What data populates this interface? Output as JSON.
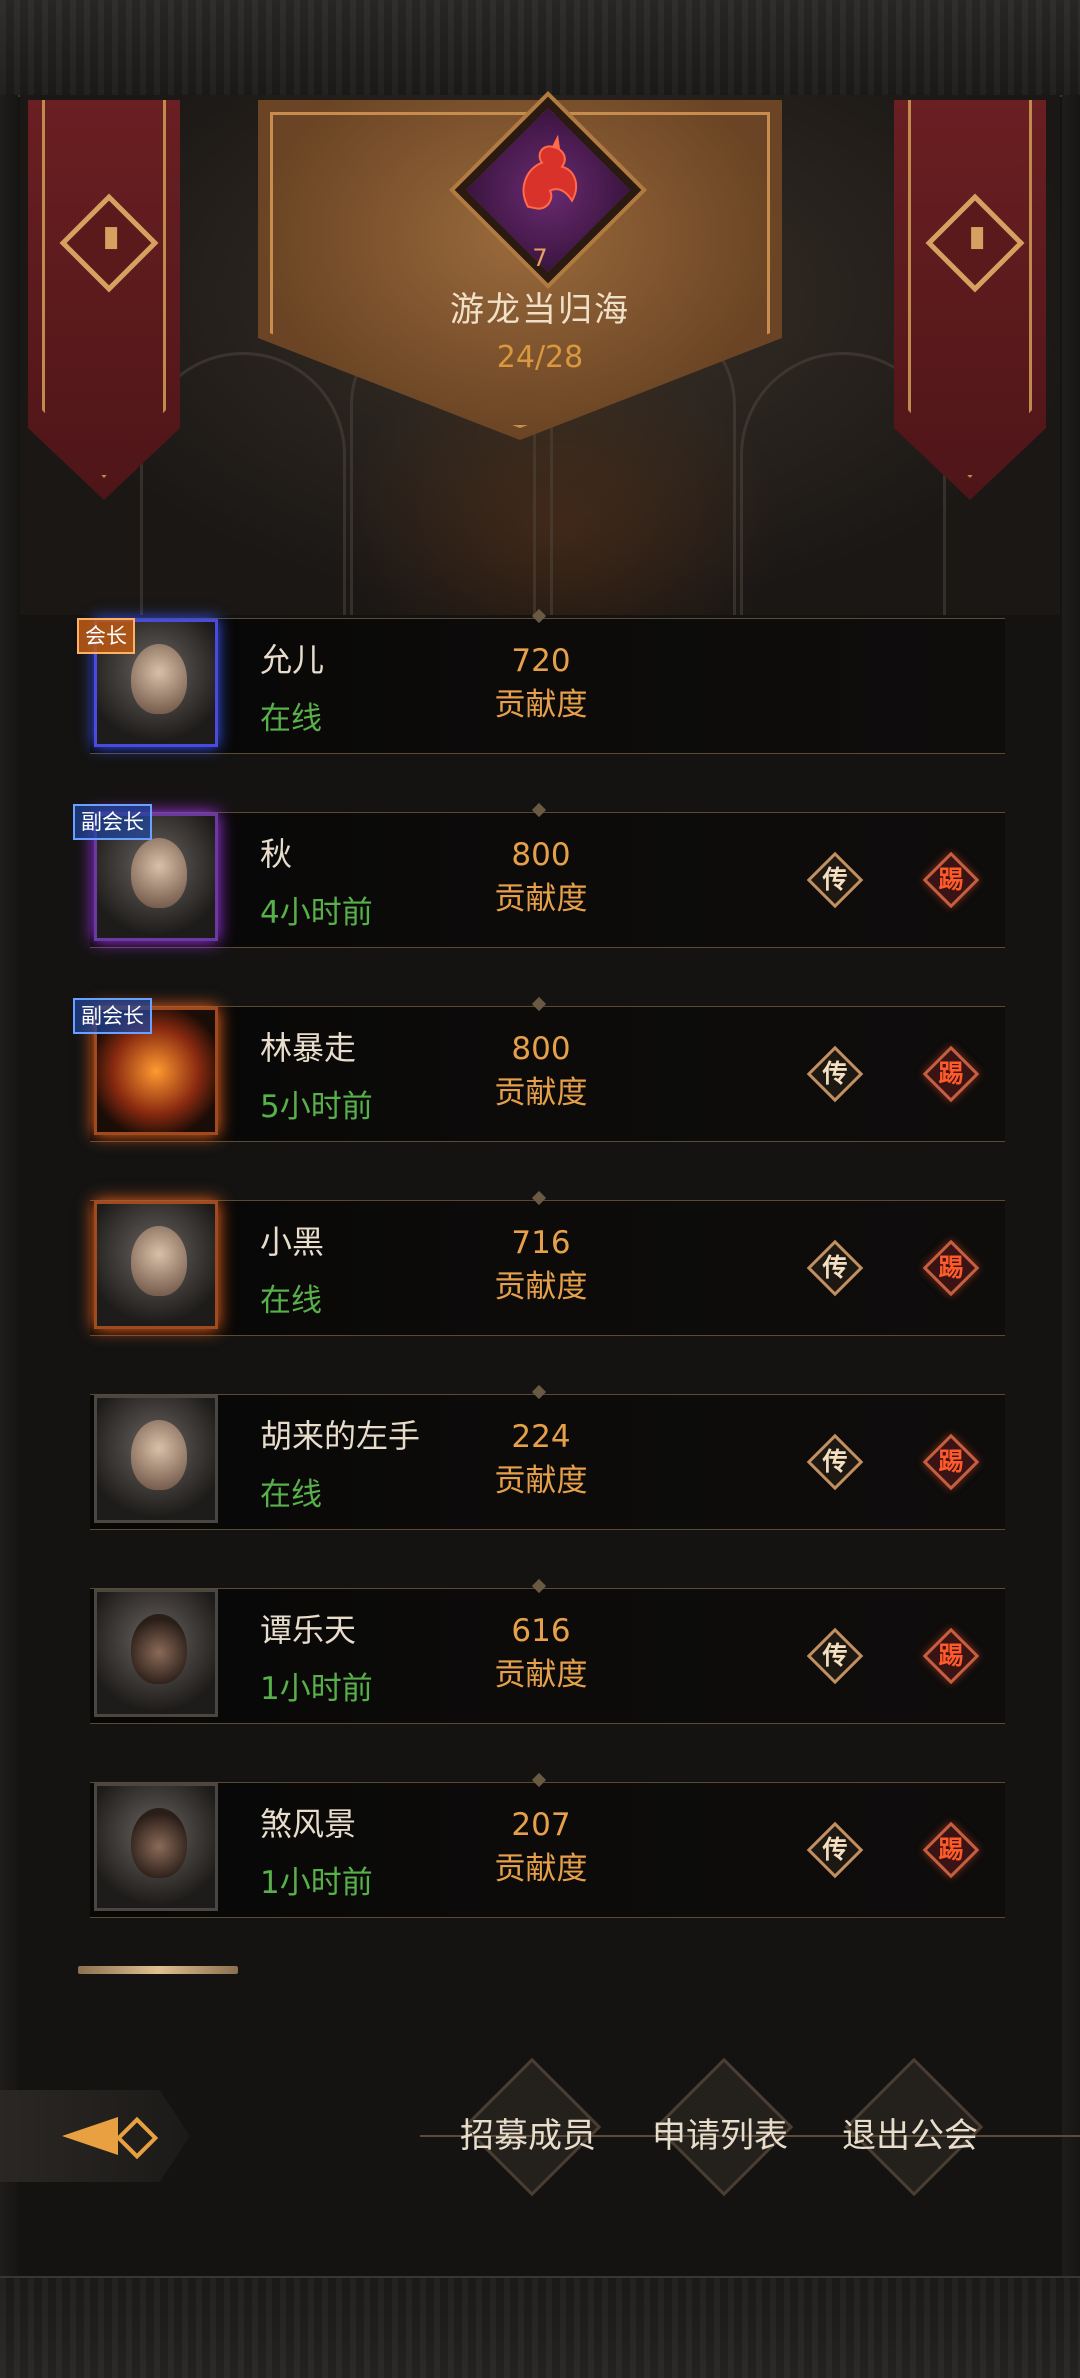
{
  "guild": {
    "level": "7",
    "name": "游龙当归海",
    "member_count": "24/28"
  },
  "actions": {
    "transfer": "传",
    "kick": "踢"
  },
  "members": [
    {
      "name": "允儿",
      "status": "在线",
      "contribution": "720",
      "contribution_label": "贡献度",
      "rank": "会长"
    },
    {
      "name": "秋",
      "status": "4小时前",
      "contribution": "800",
      "contribution_label": "贡献度",
      "rank": "副会长"
    },
    {
      "name": "林暴走",
      "status": "5小时前",
      "contribution": "800",
      "contribution_label": "贡献度",
      "rank": "副会长"
    },
    {
      "name": "小黑",
      "status": "在线",
      "contribution": "716",
      "contribution_label": "贡献度",
      "rank": ""
    },
    {
      "name": "胡来的左手",
      "status": "在线",
      "contribution": "224",
      "contribution_label": "贡献度",
      "rank": ""
    },
    {
      "name": "谭乐天",
      "status": "1小时前",
      "contribution": "616",
      "contribution_label": "贡献度",
      "rank": ""
    },
    {
      "name": "煞风景",
      "status": "1小时前",
      "contribution": "207",
      "contribution_label": "贡献度",
      "rank": ""
    }
  ],
  "bottom_bar": {
    "recruit": "招募成员",
    "applications": "申请列表",
    "leave": "退出公会"
  },
  "colors": {
    "online": "#58b04a",
    "contribution": "#e7a04a",
    "kick": "#ff5a2a",
    "banner": "#6a1f22"
  },
  "icons": {
    "guild_emblem": "red-dragon-icon",
    "back": "back-arrow-icon",
    "banner_emblem": "chevron-diamond-icon"
  }
}
